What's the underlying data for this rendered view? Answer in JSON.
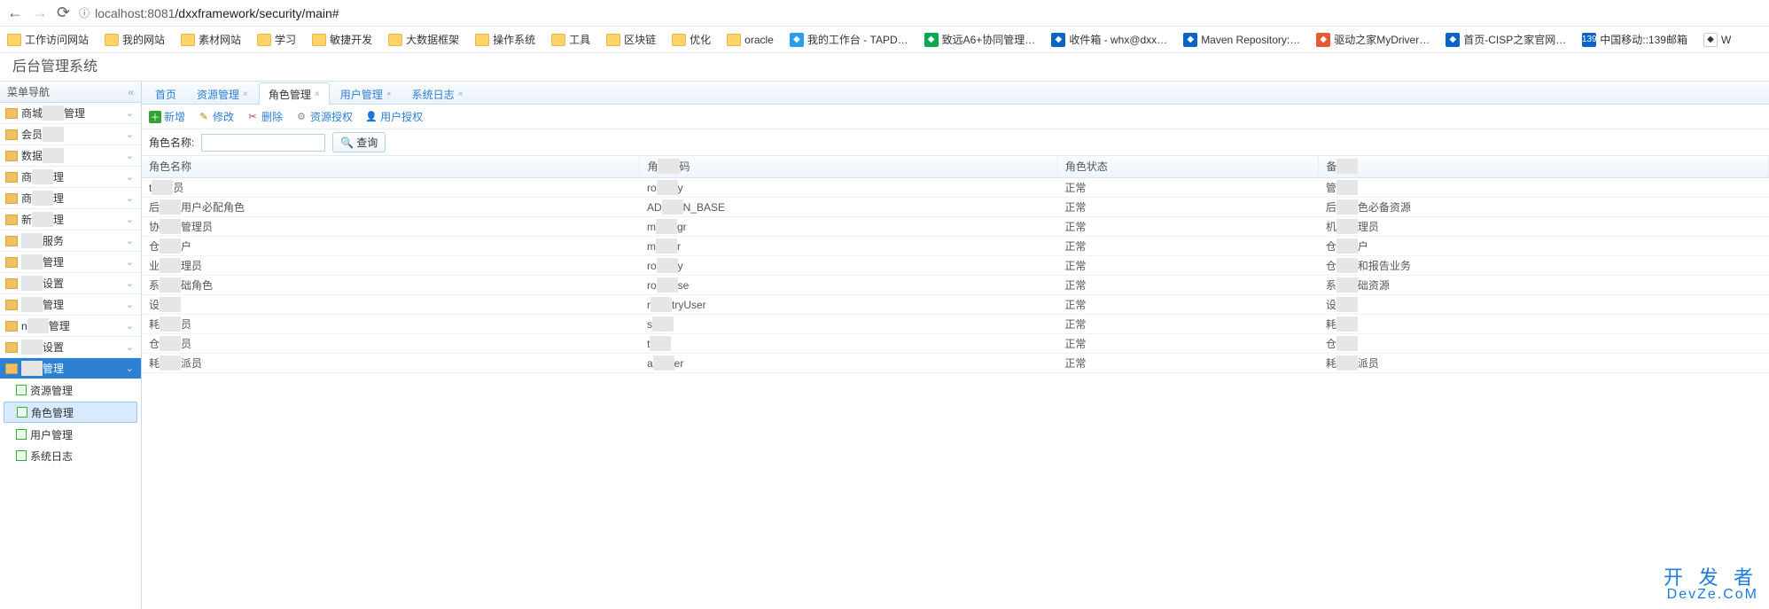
{
  "browser": {
    "url_host": "localhost:8081",
    "url_path": "/dxxframework/security/main#",
    "info_icon": "ⓘ"
  },
  "bookmarks": [
    {
      "label": "工作访问网站",
      "type": "folder"
    },
    {
      "label": "我的网站",
      "type": "folder"
    },
    {
      "label": "素材网站",
      "type": "folder"
    },
    {
      "label": "学习",
      "type": "folder"
    },
    {
      "label": "敏捷开发",
      "type": "folder"
    },
    {
      "label": "大数据框架",
      "type": "folder"
    },
    {
      "label": "操作系统",
      "type": "folder"
    },
    {
      "label": "工具",
      "type": "folder"
    },
    {
      "label": "区块链",
      "type": "folder"
    },
    {
      "label": "优化",
      "type": "folder"
    },
    {
      "label": "oracle",
      "type": "folder"
    },
    {
      "label": "我的工作台 - TAPD…",
      "type": "icon",
      "cls": "c1"
    },
    {
      "label": "致远A6+协同管理…",
      "type": "icon",
      "cls": "c2"
    },
    {
      "label": "收件箱 - whx@dxx…",
      "type": "icon",
      "cls": "c3"
    },
    {
      "label": "Maven Repository:…",
      "type": "icon",
      "cls": "c3"
    },
    {
      "label": "驱动之家MyDriver…",
      "type": "icon",
      "cls": "c4"
    },
    {
      "label": "首页-CISP之家官网…",
      "type": "icon",
      "cls": "c5"
    },
    {
      "label": "中国移动::139邮箱",
      "type": "icon",
      "cls": "c3",
      "prefix": "139"
    },
    {
      "label": "W",
      "type": "icon",
      "cls": "c6"
    }
  ],
  "header": {
    "title": "后台管理系统"
  },
  "sidebar": {
    "title": "菜单导航",
    "collapse": "«",
    "items": [
      {
        "label_pre": "商城",
        "label_suf": "管理",
        "redact": true
      },
      {
        "label_pre": "会员",
        "label_suf": "",
        "redact": true
      },
      {
        "label_pre": "数据",
        "label_suf": "",
        "redact": true
      },
      {
        "label_pre": "商",
        "label_suf": "理",
        "redact": true
      },
      {
        "label_pre": "商",
        "label_suf": "理",
        "redact": true
      },
      {
        "label_pre": "新",
        "label_suf": "理",
        "redact": true
      },
      {
        "label_pre": "",
        "label_suf": "服务",
        "redact": true
      },
      {
        "label_pre": "",
        "label_suf": "管理",
        "redact": true
      },
      {
        "label_pre": "",
        "label_suf": "设置",
        "redact": true
      },
      {
        "label_pre": "",
        "label_suf": "管理",
        "redact": true
      },
      {
        "label_pre": "n",
        "label_suf": "管理",
        "redact": true
      },
      {
        "label_pre": "",
        "label_suf": "设置",
        "redact": true
      },
      {
        "label_pre": "",
        "label_suf": "管理",
        "redact": true,
        "active": true
      }
    ],
    "leaves": [
      {
        "label": "资源管理"
      },
      {
        "label": "角色管理",
        "active": true
      },
      {
        "label": "用户管理"
      },
      {
        "label": "系统日志"
      }
    ]
  },
  "tabs": [
    {
      "label": "首页",
      "closable": false
    },
    {
      "label": "资源管理",
      "closable": true
    },
    {
      "label": "角色管理",
      "closable": true,
      "active": true
    },
    {
      "label": "用户管理",
      "closable": true
    },
    {
      "label": "系统日志",
      "closable": true
    }
  ],
  "toolbar": {
    "add": "新增",
    "edit": "修改",
    "del": "删除",
    "auth": "资源授权",
    "uauth": "用户授权"
  },
  "search": {
    "label": "角色名称:",
    "placeholder": "",
    "btn": "查询"
  },
  "table": {
    "headers": [
      "角色名称",
      "角色代码",
      "角色状态",
      "备注"
    ],
    "header_redact": [
      false,
      true,
      false,
      true
    ],
    "rows": [
      {
        "c0": {
          "pre": "t",
          "suf": "员"
        },
        "c1": {
          "pre": "ro",
          "suf": "y"
        },
        "c2": "正常",
        "c3": {
          "pre": "管",
          "suf": ""
        }
      },
      {
        "c0": {
          "pre": "后",
          "suf": "用户必配角色"
        },
        "c1": {
          "pre": "AD",
          "suf": "N_BASE"
        },
        "c2": "正常",
        "c3": {
          "pre": "后",
          "suf": "色必备资源"
        }
      },
      {
        "c0": {
          "pre": "协",
          "suf": "管理员"
        },
        "c1": {
          "pre": "m",
          "suf": "gr"
        },
        "c2": "正常",
        "c3": {
          "pre": "机",
          "suf": "理员"
        }
      },
      {
        "c0": {
          "pre": "仓",
          "suf": "户"
        },
        "c1": {
          "pre": "m",
          "suf": "r"
        },
        "c2": "正常",
        "c3": {
          "pre": "仓",
          "suf": "户"
        }
      },
      {
        "c0": {
          "pre": "业",
          "suf": "理员"
        },
        "c1": {
          "pre": "ro",
          "suf": "y"
        },
        "c2": "正常",
        "c3": {
          "pre": "仓",
          "suf": "和报告业务"
        }
      },
      {
        "c0": {
          "pre": "系",
          "suf": "础角色"
        },
        "c1": {
          "pre": "ro",
          "suf": "se"
        },
        "c2": "正常",
        "c3": {
          "pre": "系",
          "suf": "础资源"
        }
      },
      {
        "c0": {
          "pre": "设",
          "suf": ""
        },
        "c1": {
          "pre": "r",
          "suf": "tryUser"
        },
        "c2": "正常",
        "c3": {
          "pre": "设",
          "suf": ""
        }
      },
      {
        "c0": {
          "pre": "耗",
          "suf": "员"
        },
        "c1": {
          "pre": "s",
          "suf": ""
        },
        "c2": "正常",
        "c3": {
          "pre": "耗",
          "suf": ""
        }
      },
      {
        "c0": {
          "pre": "仓",
          "suf": "员"
        },
        "c1": {
          "pre": "t",
          "suf": ""
        },
        "c2": "正常",
        "c3": {
          "pre": "仓",
          "suf": ""
        }
      },
      {
        "c0": {
          "pre": "耗",
          "suf": "派员"
        },
        "c1": {
          "pre": "a",
          "suf": "er"
        },
        "c2": "正常",
        "c3": {
          "pre": "耗",
          "suf": "派员"
        }
      }
    ]
  },
  "watermark": {
    "line1": "开 发 者",
    "line2": "DevZe.CoM"
  }
}
